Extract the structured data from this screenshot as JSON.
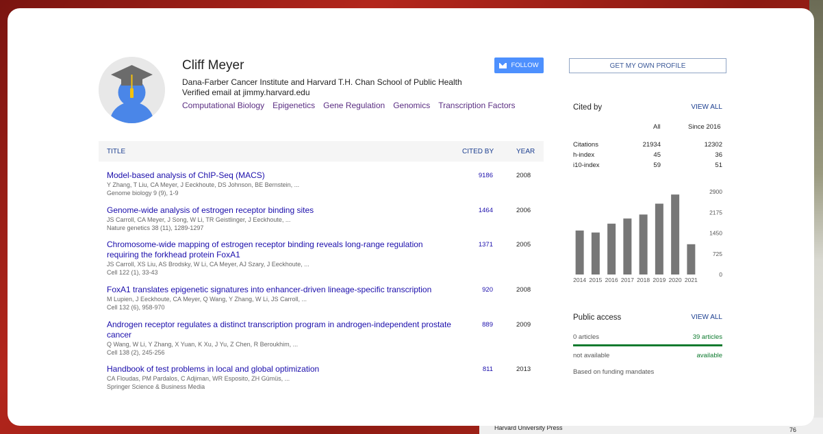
{
  "profile": {
    "name": "Cliff Meyer",
    "affiliation": "Dana-Farber Cancer Institute and Harvard T.H. Chan School of Public Health",
    "email": "Verified email at jimmy.harvard.edu",
    "interests": [
      "Computational Biology",
      "Epigenetics",
      "Gene Regulation",
      "Genomics",
      "Transcription Factors"
    ]
  },
  "buttons": {
    "follow": "FOLLOW",
    "get_profile": "GET MY OWN PROFILE"
  },
  "table": {
    "headers": {
      "title": "TITLE",
      "cited_by": "CITED BY",
      "year": "YEAR"
    },
    "rows": [
      {
        "title": "Model-based analysis of ChIP-Seq (MACS)",
        "authors": "Y Zhang, T Liu, CA Meyer, J Eeckhoute, DS Johnson, BE Bernstein, ...",
        "venue": "Genome biology 9 (9), 1-9",
        "cited": "9186",
        "year": "2008"
      },
      {
        "title": "Genome-wide analysis of estrogen receptor binding sites",
        "authors": "JS Carroll, CA Meyer, J Song, W Li, TR Geistlinger, J Eeckhoute, ...",
        "venue": "Nature genetics 38 (11), 1289-1297",
        "cited": "1464",
        "year": "2006"
      },
      {
        "title": "Chromosome-wide mapping of estrogen receptor binding reveals long-range regulation requiring the forkhead protein FoxA1",
        "authors": "JS Carroll, XS Liu, AS Brodsky, W Li, CA Meyer, AJ Szary, J Eeckhoute, ...",
        "venue": "Cell 122 (1), 33-43",
        "cited": "1371",
        "year": "2005"
      },
      {
        "title": "FoxA1 translates epigenetic signatures into enhancer-driven lineage-specific transcription",
        "authors": "M Lupien, J Eeckhoute, CA Meyer, Q Wang, Y Zhang, W Li, JS Carroll, ...",
        "venue": "Cell 132 (6), 958-970",
        "cited": "920",
        "year": "2008"
      },
      {
        "title": "Androgen receptor regulates a distinct transcription program in androgen-independent prostate cancer",
        "authors": "Q Wang, W Li, Y Zhang, X Yuan, K Xu, J Yu, Z Chen, R Beroukhim, ...",
        "venue": "Cell 138 (2), 245-256",
        "cited": "889",
        "year": "2009"
      },
      {
        "title": "Handbook of test problems in local and global optimization",
        "authors": "CA Floudas, PM Pardalos, C Adjiman, WR Esposito, ZH Gümüs, ...",
        "venue": "Springer Science & Business Media",
        "cited": "811",
        "year": "2013"
      }
    ]
  },
  "cited_by": {
    "heading": "Cited by",
    "view_all": "VIEW ALL",
    "col_all": "All",
    "col_since": "Since 2016",
    "stats": [
      {
        "label": "Citations",
        "all": "21934",
        "since": "12302"
      },
      {
        "label": "h-index",
        "all": "45",
        "since": "36"
      },
      {
        "label": "i10-index",
        "all": "59",
        "since": "51"
      }
    ]
  },
  "chart_data": {
    "type": "bar",
    "categories": [
      "2014",
      "2015",
      "2016",
      "2017",
      "2018",
      "2019",
      "2020",
      "2021"
    ],
    "values": [
      1540,
      1470,
      1780,
      1960,
      2100,
      2480,
      2800,
      1060
    ],
    "y_ticks": [
      "2900",
      "2175",
      "1450",
      "725",
      "0"
    ],
    "ylim": [
      0,
      2900
    ],
    "bar_color": "#777777"
  },
  "public_access": {
    "heading": "Public access",
    "view_all": "VIEW ALL",
    "left_count": "0 articles",
    "right_count": "39 articles",
    "left_status": "not available",
    "right_status": "available",
    "note": "Based on funding mandates",
    "available_fraction": 1.0,
    "bar_color": "#0d7a2e"
  },
  "background": {
    "publisher_text": "Harvard University Press",
    "page_number": "76"
  }
}
